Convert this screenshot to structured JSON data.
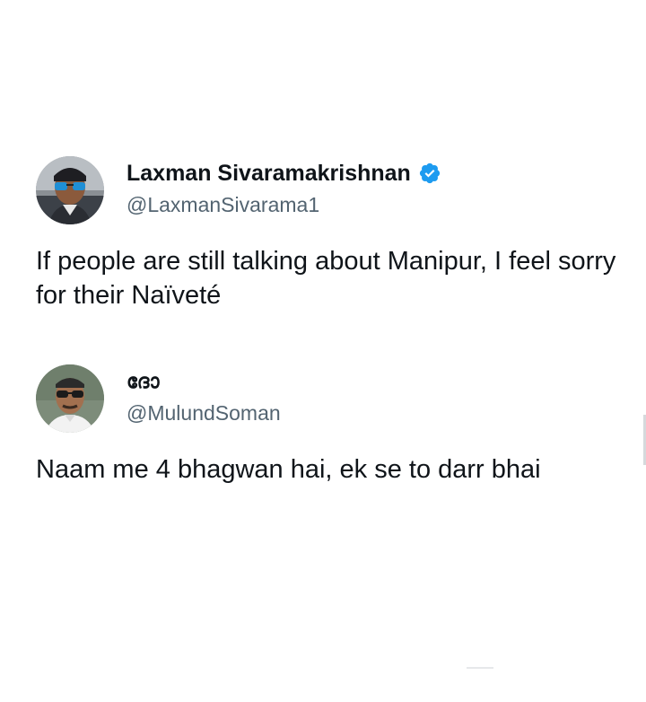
{
  "tweets": [
    {
      "display_name": "Laxman Sivaramakrishnan",
      "handle": "@LaxmanSivarama1",
      "verified": true,
      "text": "If people are still talking about Manipur, I feel sorry for their Naïveté",
      "avatar_icon": "profile-photo-sunglasses"
    },
    {
      "display_name": "ദോ",
      "handle": "@MulundSoman",
      "verified": false,
      "text": "Naam me 4 bhagwan hai, ek se to darr bhai",
      "avatar_icon": "profile-photo-sunglasses"
    }
  ],
  "colors": {
    "text": "#0f1419",
    "handle": "#536471",
    "verified": "#1d9bf0"
  }
}
